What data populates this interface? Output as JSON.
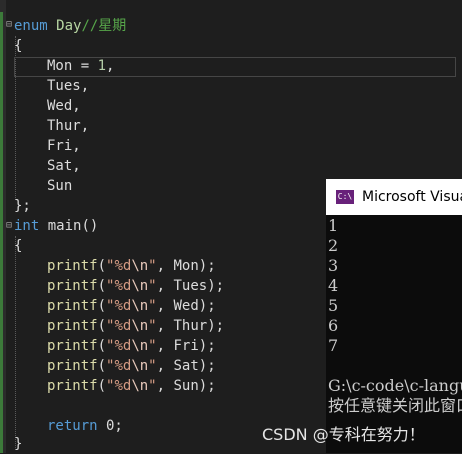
{
  "code": {
    "enum_kw": "enum",
    "enum_name": "Day",
    "enum_comment": "//星期",
    "open_brace": "{",
    "first_member": "Mon",
    "first_assign": " = ",
    "first_value": "1",
    "first_comma": ",",
    "members": [
      "Tues,",
      "Wed,",
      "Thur,",
      "Fri,",
      "Sat,",
      "Sun"
    ],
    "enum_close": "};",
    "main_kw": "int",
    "main_sig": " main()",
    "body_open": "{",
    "printf_fn": "printf",
    "printf_lp": "(",
    "printf_quote_open": "\"",
    "printf_fmt": "%d",
    "printf_esc": "\\n",
    "printf_quote_close": "\"",
    "printf_sep": ", ",
    "printf_args": [
      "Mon",
      "Tues",
      "Wed",
      "Thur",
      "Fri",
      "Sat",
      "Sun"
    ],
    "printf_end": ");",
    "return_kw": "return",
    "return_val": " 0;",
    "body_close": "}"
  },
  "console": {
    "title": "Microsoft Visual Studio 调试控制台",
    "icon_text": "C:\\",
    "output_lines": [
      "1",
      "2",
      "3",
      "4",
      "5",
      "6",
      "7",
      "",
      "G:\\c-code\\c-language",
      "按任意键关闭此窗口"
    ]
  },
  "watermark": "CSDN @专科在努力！"
}
